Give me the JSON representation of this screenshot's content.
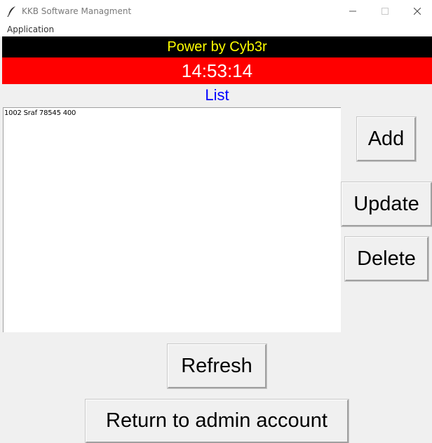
{
  "window": {
    "title": "KKB Software Managment"
  },
  "menu": {
    "items": [
      "Application"
    ]
  },
  "banner": {
    "credit": "Power by Cyb3r",
    "clock": "14:53:14",
    "list_title": "List"
  },
  "list": {
    "rows": [
      "1002 Sraf 78545 400"
    ]
  },
  "buttons": {
    "add": "Add",
    "update": "Update",
    "delete": "Delete",
    "refresh": "Refresh",
    "return": "Return to admin account"
  },
  "colors": {
    "credit_bg": "#000000",
    "credit_text": "#ffff00",
    "clock_bg": "#ff0000",
    "clock_text": "#ffffff",
    "list_title": "#0000ff"
  },
  "icons": {
    "app": "feather-icon",
    "minimize": "minimize-icon",
    "maximize": "maximize-icon",
    "close": "close-icon"
  }
}
